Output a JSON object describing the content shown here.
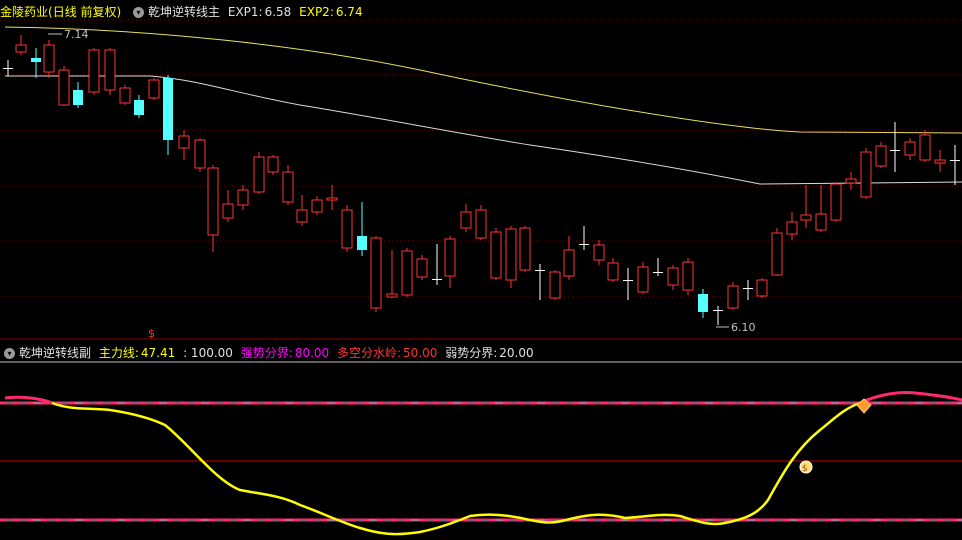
{
  "main_panel": {
    "stock_name": "金陵药业",
    "period": "(日线 前复权)",
    "indicator_name": "乾坤逆转线主",
    "exp1_label": "EXP1:",
    "exp1_value": "6.58",
    "exp2_label": "EXP2:",
    "exp2_value": "6.74",
    "high_annotation": "7.14",
    "low_annotation": "6.10",
    "colors": {
      "up": "#ff3333",
      "down": "#54ffff",
      "ma_yellow": "#e8e05c",
      "ma_white": "#dcdcdc",
      "grid": "#8b0000"
    }
  },
  "sub_panel": {
    "indicator_name": "乾坤逆转线副",
    "main_line_label": "主力线:",
    "main_line_value": "47.41",
    "level_100": ": 100.00",
    "strong_label": "强势分界:",
    "strong_value": "80.00",
    "mid_label": "多空分水岭:",
    "mid_value": "50.00",
    "weak_label": "弱势分界:",
    "weak_value": "20.00",
    "colors": {
      "main_line": "#ffff00",
      "strong": "#ff00ff",
      "mid": "#ff3333",
      "weak": "#c0c0c0"
    }
  }
}
